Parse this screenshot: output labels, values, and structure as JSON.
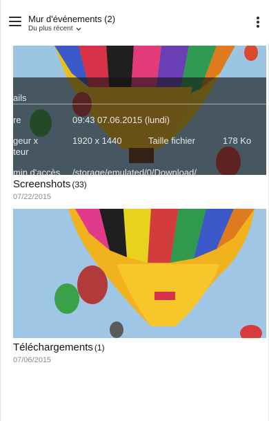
{
  "header": {
    "title": "Mur d'événements (2)",
    "sort_label": "Du plus récent"
  },
  "albums": [
    {
      "name": "Screenshots",
      "count": "(33)",
      "date": "07/22/2015",
      "details_overlay": {
        "section_label": "ails",
        "rows": [
          {
            "label": "re",
            "value": "09:43 07.06.2015 (lundi)"
          },
          {
            "label": "geur x",
            "value": "1920 x 1440",
            "extra_label": "Taille fichier",
            "extra_value": "178 Ko"
          },
          {
            "label": "teur",
            "value": ""
          },
          {
            "label": "min d'accès",
            "value": "/storage/emulated/0/Download/"
          }
        ]
      }
    },
    {
      "name": "Téléchargements",
      "count": "(1)",
      "date": "07/06/2015"
    }
  ],
  "colors": {
    "sky": "#9cc4e3",
    "text_primary": "#111111",
    "text_secondary": "#8a8a8a"
  },
  "icons": [
    "menu-icon",
    "chevron-down-icon",
    "more-vert-icon"
  ]
}
